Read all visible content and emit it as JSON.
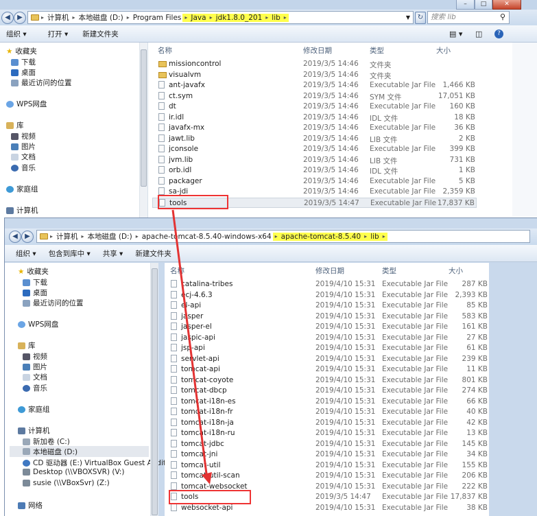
{
  "window1": {
    "address": [
      "计算机",
      "本地磁盘 (D:)",
      "Program Files",
      "Java",
      "jdk1.8.0_201",
      "lib"
    ],
    "search_placeholder": "搜索 lib",
    "toolbar": {
      "organize": "组织 ▾",
      "open": "打开 ▾",
      "new_folder": "新建文件夹"
    },
    "nav": [
      "收藏夹",
      "下载",
      "桌面",
      "最近访问的位置",
      "WPS网盘",
      "库",
      "视频",
      "图片",
      "文档",
      "音乐",
      "家庭组",
      "计算机"
    ],
    "columns": {
      "name": "名称",
      "date": "修改日期",
      "type": "类型",
      "size": "大小"
    },
    "files": [
      {
        "name": "missioncontrol",
        "date": "2019/3/5 14:46",
        "type": "文件夹",
        "size": ""
      },
      {
        "name": "visualvm",
        "date": "2019/3/5 14:46",
        "type": "文件夹",
        "size": ""
      },
      {
        "name": "ant-javafx",
        "date": "2019/3/5 14:46",
        "type": "Executable Jar File",
        "size": "1,466 KB"
      },
      {
        "name": "ct.sym",
        "date": "2019/3/5 14:46",
        "type": "SYM 文件",
        "size": "17,051 KB"
      },
      {
        "name": "dt",
        "date": "2019/3/5 14:46",
        "type": "Executable Jar File",
        "size": "160 KB"
      },
      {
        "name": "ir.idl",
        "date": "2019/3/5 14:46",
        "type": "IDL 文件",
        "size": "18 KB"
      },
      {
        "name": "javafx-mx",
        "date": "2019/3/5 14:46",
        "type": "Executable Jar File",
        "size": "36 KB"
      },
      {
        "name": "jawt.lib",
        "date": "2019/3/5 14:46",
        "type": "LIB 文件",
        "size": "2 KB"
      },
      {
        "name": "jconsole",
        "date": "2019/3/5 14:46",
        "type": "Executable Jar File",
        "size": "399 KB"
      },
      {
        "name": "jvm.lib",
        "date": "2019/3/5 14:46",
        "type": "LIB 文件",
        "size": "731 KB"
      },
      {
        "name": "orb.idl",
        "date": "2019/3/5 14:46",
        "type": "IDL 文件",
        "size": "1 KB"
      },
      {
        "name": "packager",
        "date": "2019/3/5 14:46",
        "type": "Executable Jar File",
        "size": "5 KB"
      },
      {
        "name": "sa-jdi",
        "date": "2019/3/5 14:46",
        "type": "Executable Jar File",
        "size": "2,359 KB"
      },
      {
        "name": "tools",
        "date": "2019/3/5 14:47",
        "type": "Executable Jar File",
        "size": "17,837 KB"
      }
    ]
  },
  "window2": {
    "address": [
      "计算机",
      "本地磁盘 (D:)",
      "apache-tomcat-8.5.40-windows-x64",
      "apache-tomcat-8.5.40",
      "lib"
    ],
    "toolbar": {
      "organize": "组织 ▾",
      "include": "包含到库中 ▾",
      "share": "共享 ▾",
      "new_folder": "新建文件夹"
    },
    "nav": [
      "收藏夹",
      "下载",
      "桌面",
      "最近访问的位置",
      "WPS网盘",
      "库",
      "视频",
      "图片",
      "文档",
      "音乐",
      "家庭组",
      "计算机",
      "新加卷 (C:)",
      "本地磁盘 (D:)",
      "CD 驱动器 (E:) VirtualBox Guest Addition",
      "Desktop (\\\\VBOXSVR) (V:)",
      "susie (\\\\VBoxSvr) (Z:)",
      "网络"
    ],
    "columns": {
      "name": "名称",
      "date": "修改日期",
      "type": "类型",
      "size": "大小"
    },
    "files": [
      {
        "name": "catalina-tribes",
        "date": "2019/4/10 15:31",
        "type": "Executable Jar File",
        "size": "287 KB"
      },
      {
        "name": "ecj-4.6.3",
        "date": "2019/4/10 15:31",
        "type": "Executable Jar File",
        "size": "2,393 KB"
      },
      {
        "name": "el-api",
        "date": "2019/4/10 15:31",
        "type": "Executable Jar File",
        "size": "85 KB"
      },
      {
        "name": "jasper",
        "date": "2019/4/10 15:31",
        "type": "Executable Jar File",
        "size": "583 KB"
      },
      {
        "name": "jasper-el",
        "date": "2019/4/10 15:31",
        "type": "Executable Jar File",
        "size": "161 KB"
      },
      {
        "name": "jaspic-api",
        "date": "2019/4/10 15:31",
        "type": "Executable Jar File",
        "size": "27 KB"
      },
      {
        "name": "jsp-api",
        "date": "2019/4/10 15:31",
        "type": "Executable Jar File",
        "size": "61 KB"
      },
      {
        "name": "servlet-api",
        "date": "2019/4/10 15:31",
        "type": "Executable Jar File",
        "size": "239 KB"
      },
      {
        "name": "tomcat-api",
        "date": "2019/4/10 15:31",
        "type": "Executable Jar File",
        "size": "11 KB"
      },
      {
        "name": "tomcat-coyote",
        "date": "2019/4/10 15:31",
        "type": "Executable Jar File",
        "size": "801 KB"
      },
      {
        "name": "tomcat-dbcp",
        "date": "2019/4/10 15:31",
        "type": "Executable Jar File",
        "size": "274 KB"
      },
      {
        "name": "tomcat-i18n-es",
        "date": "2019/4/10 15:31",
        "type": "Executable Jar File",
        "size": "66 KB"
      },
      {
        "name": "tomcat-i18n-fr",
        "date": "2019/4/10 15:31",
        "type": "Executable Jar File",
        "size": "40 KB"
      },
      {
        "name": "tomcat-i18n-ja",
        "date": "2019/4/10 15:31",
        "type": "Executable Jar File",
        "size": "42 KB"
      },
      {
        "name": "tomcat-i18n-ru",
        "date": "2019/4/10 15:31",
        "type": "Executable Jar File",
        "size": "13 KB"
      },
      {
        "name": "tomcat-jdbc",
        "date": "2019/4/10 15:31",
        "type": "Executable Jar File",
        "size": "145 KB"
      },
      {
        "name": "tomcat-jni",
        "date": "2019/4/10 15:31",
        "type": "Executable Jar File",
        "size": "34 KB"
      },
      {
        "name": "tomcat-util",
        "date": "2019/4/10 15:31",
        "type": "Executable Jar File",
        "size": "155 KB"
      },
      {
        "name": "tomcat-util-scan",
        "date": "2019/4/10 15:31",
        "type": "Executable Jar File",
        "size": "206 KB"
      },
      {
        "name": "tomcat-websocket",
        "date": "2019/4/10 15:31",
        "type": "Executable Jar File",
        "size": "222 KB"
      },
      {
        "name": "tools",
        "date": "2019/3/5 14:47",
        "type": "Executable Jar File",
        "size": "17,837 KB"
      },
      {
        "name": "websocket-api",
        "date": "2019/4/10 15:31",
        "type": "Executable Jar File",
        "size": "38 KB"
      }
    ]
  },
  "colors": {
    "highlight": "#ffff4d",
    "annotation": "#e33333",
    "window_frame": "#c9d9ec"
  }
}
